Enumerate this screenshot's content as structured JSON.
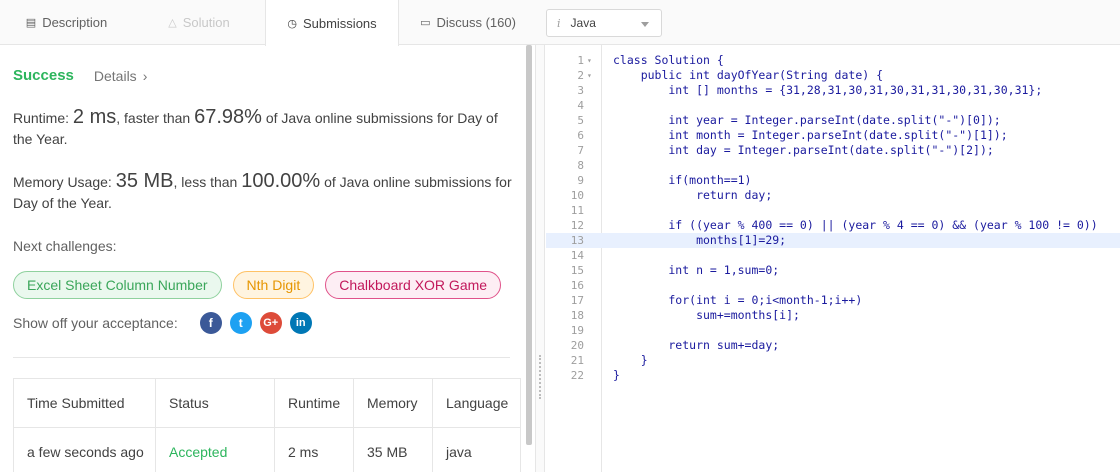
{
  "tabs": [
    {
      "label": "Description",
      "icon": "description-icon"
    },
    {
      "label": "Solution",
      "icon": "flask-icon"
    },
    {
      "label": "Submissions",
      "icon": "clock-icon"
    },
    {
      "label": "Discuss (160)",
      "icon": "chat-icon"
    }
  ],
  "language_select": {
    "value": "Java"
  },
  "result": {
    "status": "Success",
    "details_label": "Details"
  },
  "runtime": {
    "label": "Runtime:",
    "value": "2 ms",
    "mid": ", faster than ",
    "percent": "67.98%",
    "tail": " of Java online submissions for Day of the Year."
  },
  "memory": {
    "label": "Memory Usage:",
    "value": "35 MB",
    "mid": ", less than ",
    "percent": "100.00%",
    "tail": " of Java online submissions for Day of the Year."
  },
  "next_challenges": {
    "label": "Next challenges:",
    "items": [
      "Excel Sheet Column Number",
      "Nth Digit",
      "Chalkboard XOR Game"
    ]
  },
  "share": {
    "label": "Show off your acceptance:",
    "icons": [
      "facebook-icon",
      "twitter-icon",
      "google-plus-icon",
      "linkedin-icon"
    ]
  },
  "table": {
    "headers": [
      "Time Submitted",
      "Status",
      "Runtime",
      "Memory",
      "Language"
    ],
    "rows": [
      [
        "a few seconds ago",
        "Accepted",
        "2 ms",
        "35 MB",
        "java"
      ]
    ]
  },
  "code_lines": [
    "class Solution {",
    "    public int dayOfYear(String date) {",
    "        int [] months = {31,28,31,30,31,30,31,31,30,31,30,31};",
    "",
    "        int year = Integer.parseInt(date.split(\"-\")[0]);",
    "        int month = Integer.parseInt(date.split(\"-\")[1]);",
    "        int day = Integer.parseInt(date.split(\"-\")[2]);",
    "",
    "        if(month==1)",
    "            return day;",
    "",
    "        if ((year % 400 == 0) || (year % 4 == 0) && (year % 100 != 0))",
    "            months[1]=29;",
    "",
    "        int n = 1,sum=0;",
    "",
    "        for(int i = 0;i<month-1;i++)",
    "            sum+=months[i];",
    "",
    "        return sum+=day;",
    "    }",
    "}"
  ]
}
